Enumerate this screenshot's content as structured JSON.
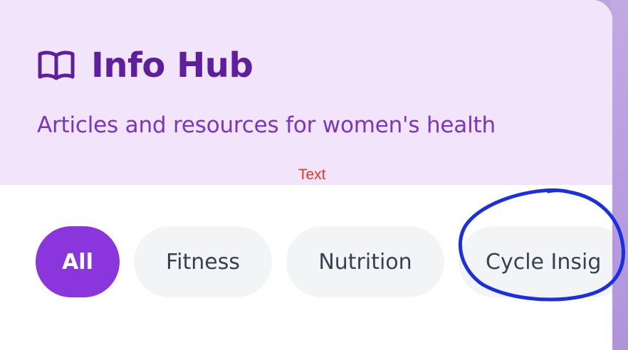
{
  "header": {
    "icon": "book-open-icon",
    "title": "Info Hub",
    "subtitle": "Articles and resources for women's health"
  },
  "annotation_text": "Text",
  "filters": {
    "chips": [
      {
        "label": "All",
        "active": true
      },
      {
        "label": "Fitness",
        "active": false
      },
      {
        "label": "Nutrition",
        "active": false
      },
      {
        "label": "Cycle Insig",
        "active": false
      }
    ]
  },
  "colors": {
    "title": "#5e1f9e",
    "subtitle": "#7a35c4",
    "header_bg": "#f1e4fb",
    "active_chip": "#8a36dc",
    "chip_bg": "#f3f4f6",
    "annotation_red": "#e5381f",
    "annotation_blue": "#1a2fe0"
  }
}
